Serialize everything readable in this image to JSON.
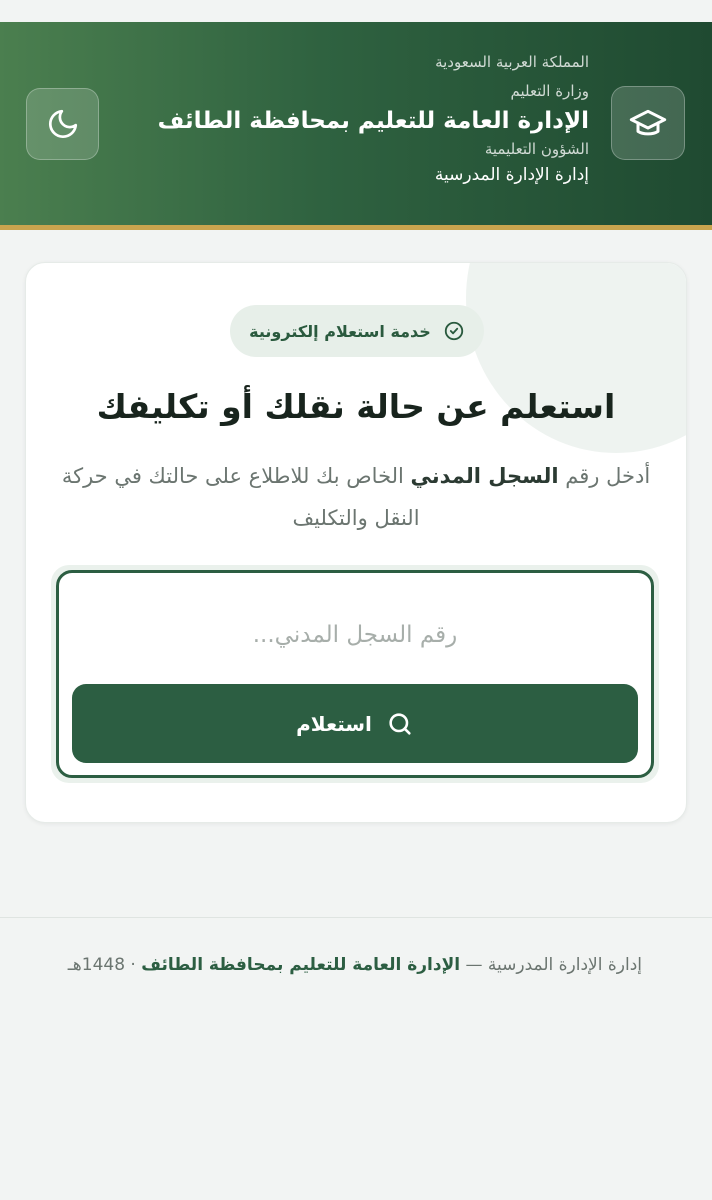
{
  "header": {
    "country": "المملكة العربية السعودية",
    "ministry": "وزارة التعليم",
    "title": "الإدارة العامة للتعليم بمحافظة الطائف",
    "department": "الشؤون التعليمية",
    "unit": "إدارة الإدارة المدرسية",
    "icons": {
      "logo": "graduation-cap-icon",
      "theme_toggle": "moon-icon"
    }
  },
  "card": {
    "badge": "خدمة استعلام إلكترونية",
    "title": "استعلم عن حالة نقلك أو تكليفك",
    "desc_prefix": "أدخل رقم ",
    "desc_bold": "السجل المدني",
    "desc_suffix": " الخاص بك للاطلاع على حالتك في حركة النقل والتكليف",
    "input": {
      "placeholder": "رقم السجل المدني...",
      "value": ""
    },
    "submit_label": "استعلام"
  },
  "footer": {
    "unit": "إدارة الإدارة المدرسية —",
    "org": "الإدارة العامة للتعليم بمحافظة الطائف",
    "year": "· 1448هـ"
  },
  "colors": {
    "primary": "#2c5e42",
    "gold": "#c9a44e",
    "badge_bg": "#e7efe9"
  }
}
